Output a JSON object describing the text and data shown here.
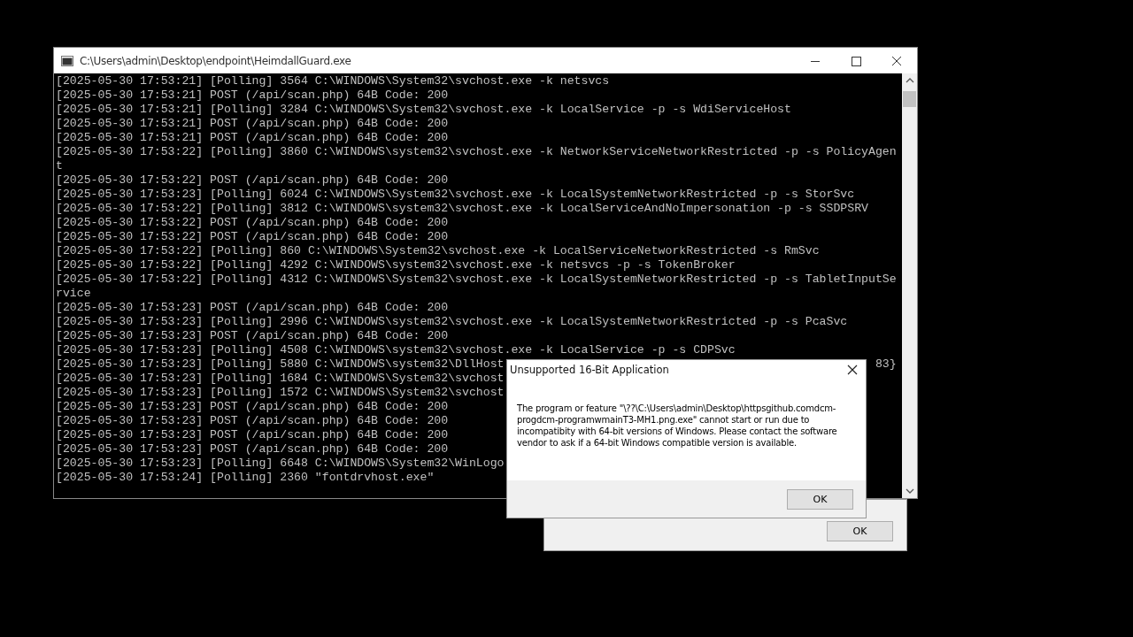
{
  "console": {
    "title": "C:\\Users\\admin\\Desktop\\endpoint\\HeimdallGuard.exe",
    "lines": [
      {
        "text": "[2025-05-30 17:53:21] [Polling] 3564 C:\\WINDOWS\\System32\\svchost.exe -k netsvcs"
      },
      {
        "text": "[2025-05-30 17:53:21] POST (/api/scan.php) 64B Code: 200"
      },
      {
        "text": "[2025-05-30 17:53:21] [Polling] 3284 C:\\WINDOWS\\System32\\svchost.exe -k LocalService -p -s WdiServiceHost"
      },
      {
        "text": "[2025-05-30 17:53:21] POST (/api/scan.php) 64B Code: 200"
      },
      {
        "text": "[2025-05-30 17:53:21] POST (/api/scan.php) 64B Code: 200"
      },
      {
        "text": "[2025-05-30 17:53:22] [Polling] 3860 C:\\WINDOWS\\system32\\svchost.exe -k NetworkServiceNetworkRestricted -p -s PolicyAgen"
      },
      {
        "text": "t"
      },
      {
        "text": "[2025-05-30 17:53:22] POST (/api/scan.php) 64B Code: 200"
      },
      {
        "text": "[2025-05-30 17:53:23] [Polling] 6024 C:\\WINDOWS\\System32\\svchost.exe -k LocalSystemNetworkRestricted -p -s StorSvc"
      },
      {
        "text": "[2025-05-30 17:53:22] [Polling] 3812 C:\\WINDOWS\\system32\\svchost.exe -k LocalServiceAndNoImpersonation -p -s SSDPSRV"
      },
      {
        "text": "[2025-05-30 17:53:22] POST (/api/scan.php) 64B Code: 200"
      },
      {
        "text": "[2025-05-30 17:53:22] POST (/api/scan.php) 64B Code: 200"
      },
      {
        "text": "[2025-05-30 17:53:22] [Polling] 860 C:\\WINDOWS\\System32\\svchost.exe -k LocalServiceNetworkRestricted -s RmSvc"
      },
      {
        "text": "[2025-05-30 17:53:22] [Polling] 4292 C:\\WINDOWS\\system32\\svchost.exe -k netsvcs -p -s TokenBroker"
      },
      {
        "text": "[2025-05-30 17:53:22] [Polling] 4312 C:\\WINDOWS\\System32\\svchost.exe -k LocalSystemNetworkRestricted -p -s TabletInputSe"
      },
      {
        "text": "rvice"
      },
      {
        "text": "[2025-05-30 17:53:23] POST (/api/scan.php) 64B Code: 200"
      },
      {
        "text": "[2025-05-30 17:53:23] [Polling] 2996 C:\\WINDOWS\\system32\\svchost.exe -k LocalSystemNetworkRestricted -p -s PcaSvc"
      },
      {
        "text": "[2025-05-30 17:53:23] POST (/api/scan.php) 64B Code: 200"
      },
      {
        "text": "[2025-05-30 17:53:23] [Polling] 4508 C:\\WINDOWS\\system32\\svchost.exe -k LocalService -p -s CDPSvc"
      },
      {
        "text": "[2025-05-30 17:53:23] [Polling] 5880 C:\\WINDOWS\\system32\\DllHost",
        "tail": "83}"
      },
      {
        "text": "[2025-05-30 17:53:23] [Polling] 1684 C:\\WINDOWS\\System32\\svchost"
      },
      {
        "text": "[2025-05-30 17:53:23] [Polling] 1572 C:\\WINDOWS\\System32\\svchost"
      },
      {
        "text": "[2025-05-30 17:53:23] POST (/api/scan.php) 64B Code: 200"
      },
      {
        "text": "[2025-05-30 17:53:23] POST (/api/scan.php) 64B Code: 200"
      },
      {
        "text": "[2025-05-30 17:53:23] POST (/api/scan.php) 64B Code: 200"
      },
      {
        "text": "[2025-05-30 17:53:23] POST (/api/scan.php) 64B Code: 200"
      },
      {
        "text": "[2025-05-30 17:53:23] [Polling] 6648 C:\\WINDOWS\\System32\\WinLogo"
      },
      {
        "text": "[2025-05-30 17:53:24] [Polling] 2360 \"fontdrvhost.exe\""
      }
    ]
  },
  "dialog": {
    "title": "Unsupported 16-Bit Application",
    "message": "The program or feature \"\\??\\C:\\Users\\admin\\Desktop\\httpsgithub.comdcm-progdcm-programwmainT3-MH1.png.exe\" cannot start or run due to incompatibity with 64-bit versions of Windows. Please contact the software vendor to ask if a 64-bit Windows compatible version is available.",
    "button": "OK"
  },
  "background_dialog": {
    "button": "OK"
  }
}
